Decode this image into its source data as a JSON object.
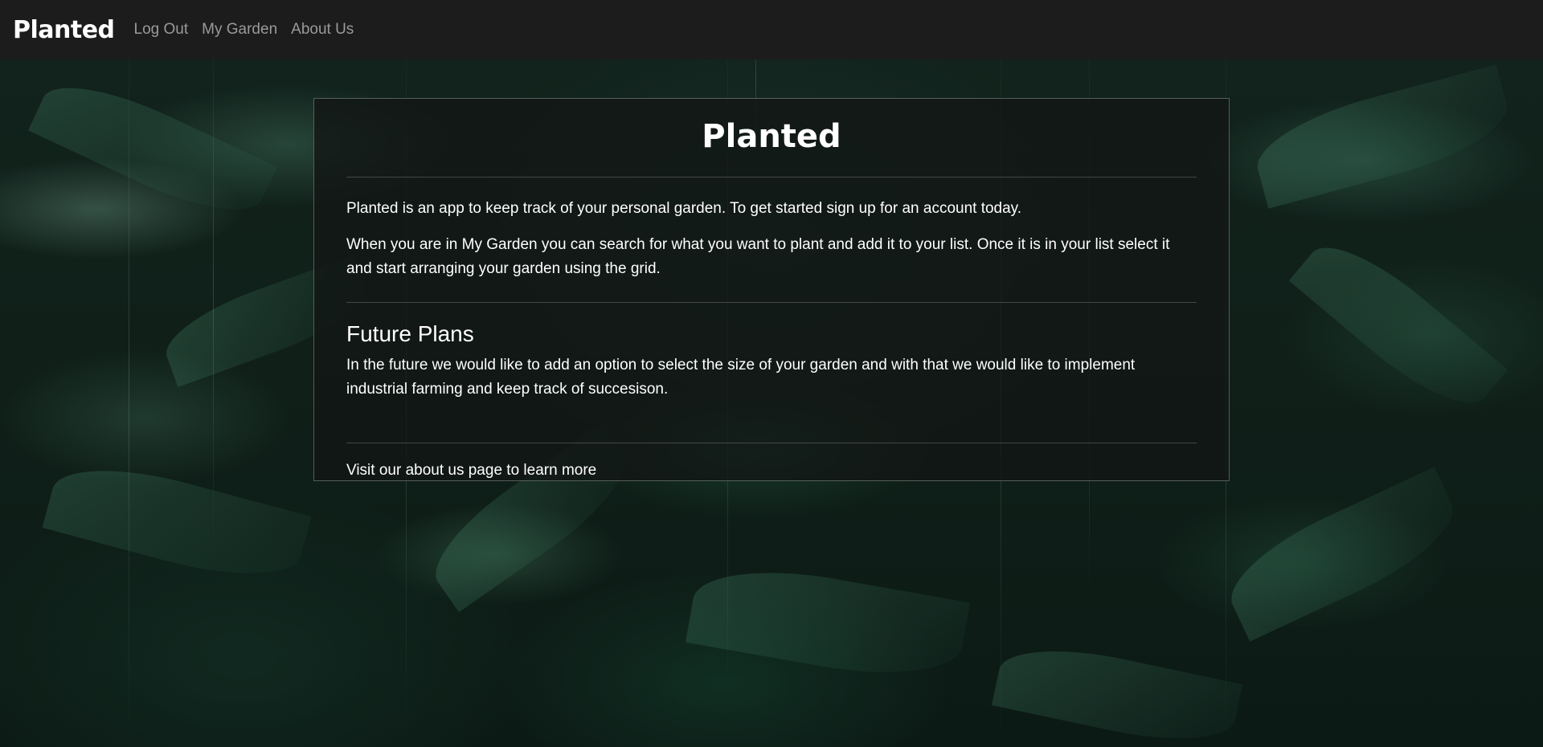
{
  "navbar": {
    "brand": "Planted",
    "links": [
      {
        "label": "Log Out"
      },
      {
        "label": "My Garden"
      },
      {
        "label": "About Us"
      }
    ]
  },
  "card": {
    "title": "Planted",
    "intro": "Planted is an app to keep track of your personal garden. To get started sign up for an account today.",
    "instructions": "When you are in My Garden you can search for what you want to plant and add it to your list. Once it is in your list select it and start arranging your garden using the grid.",
    "future_heading": "Future Plans",
    "future_text": "In the future we would like to add an option to select the size of your garden and with that we would like to implement industrial farming and keep track of succesison.",
    "about_link": "Visit our about us page to learn more"
  },
  "colors": {
    "navbar_bg": "#1c1c1c",
    "nav_link": "#9a9a9a",
    "text": "#ffffff",
    "background": "#102019"
  }
}
